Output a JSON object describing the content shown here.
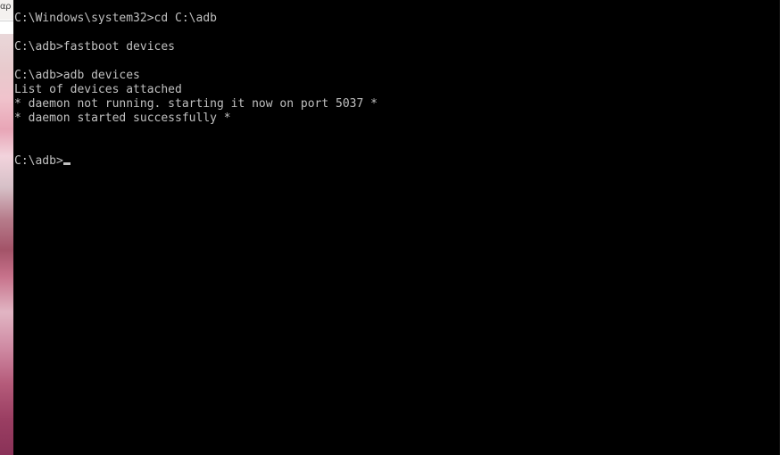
{
  "background_window": {
    "label_fragment": "αρ"
  },
  "console": {
    "lines": [
      "C:\\Windows\\system32>cd C:\\adb",
      "",
      "C:\\adb>fastboot devices",
      "",
      "C:\\adb>adb devices",
      "List of devices attached",
      "* daemon not running. starting it now on port 5037 *",
      "* daemon started successfully *",
      "",
      "",
      "C:\\adb>"
    ],
    "colors": {
      "background": "#000000",
      "text": "#c0c0c0"
    }
  }
}
